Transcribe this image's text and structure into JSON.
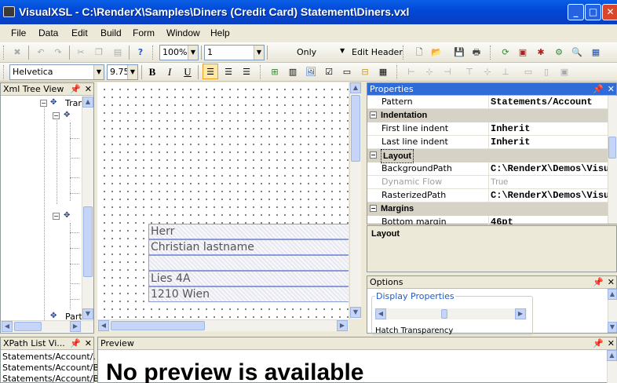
{
  "titlebar": {
    "title": "VisualXSL - C:\\RenderX\\Samples\\Diners (Credit Card) Statement\\Diners.vxl",
    "minimize": "_",
    "maximize": "□",
    "close": "✕"
  },
  "menu": [
    "File",
    "Data",
    "Edit",
    "Build",
    "Form",
    "Window",
    "Help"
  ],
  "toolbar1": {
    "zoom": "100%",
    "page": "1",
    "only_label": "Only",
    "edit_header_label": "Edit Header"
  },
  "toolbar2": {
    "font": "Helvetica",
    "size": "9.75",
    "bold": "B",
    "italic": "I",
    "underline": "U"
  },
  "xml_tree": {
    "title": "Xml Tree View",
    "nodes": [
      "Tran",
      "",
      "",
      "Part"
    ]
  },
  "xpath_list": {
    "title": "XPath List Vi...",
    "items": [
      "Statements/Account/.",
      "Statements/Account/Bo",
      "Statements/Account/Bo"
    ]
  },
  "canvas": {
    "rows": [
      "Herr",
      "Christian lastname",
      "",
      "Lies 4A",
      "1210  Wien"
    ]
  },
  "properties": {
    "title": "Properties",
    "rows": [
      {
        "type": "prop",
        "name": "Pattern",
        "value": "Statements/Account",
        "dim": false
      },
      {
        "type": "cat",
        "name": "Indentation"
      },
      {
        "type": "prop",
        "name": "First line indent",
        "value": "Inherit",
        "dim": false
      },
      {
        "type": "prop",
        "name": "Last line indent",
        "value": "Inherit",
        "dim": false
      },
      {
        "type": "cat",
        "name": "Layout"
      },
      {
        "type": "prop",
        "name": "BackgroundPath",
        "value": "C:\\RenderX\\Demos\\Visual",
        "dim": false
      },
      {
        "type": "prop",
        "name": "Dynamic Flow",
        "value": "True",
        "dim": true
      },
      {
        "type": "prop",
        "name": "RasterizedPath",
        "value": "C:\\RenderX\\Demos\\Visual",
        "dim": false
      },
      {
        "type": "cat",
        "name": "Margins"
      },
      {
        "type": "prop",
        "name": "Bottom margin",
        "value": "46pt",
        "dim": false
      }
    ],
    "description": "Layout"
  },
  "options": {
    "title": "Options",
    "group_label": "Display Properties",
    "hatch_label": "Hatch Transparency"
  },
  "preview": {
    "title": "Preview",
    "message": "No preview is available"
  },
  "colors": {
    "title_bar": "#0a5fe6",
    "active_panel": "#2f6cd8",
    "workspace": "#ece9d8"
  }
}
